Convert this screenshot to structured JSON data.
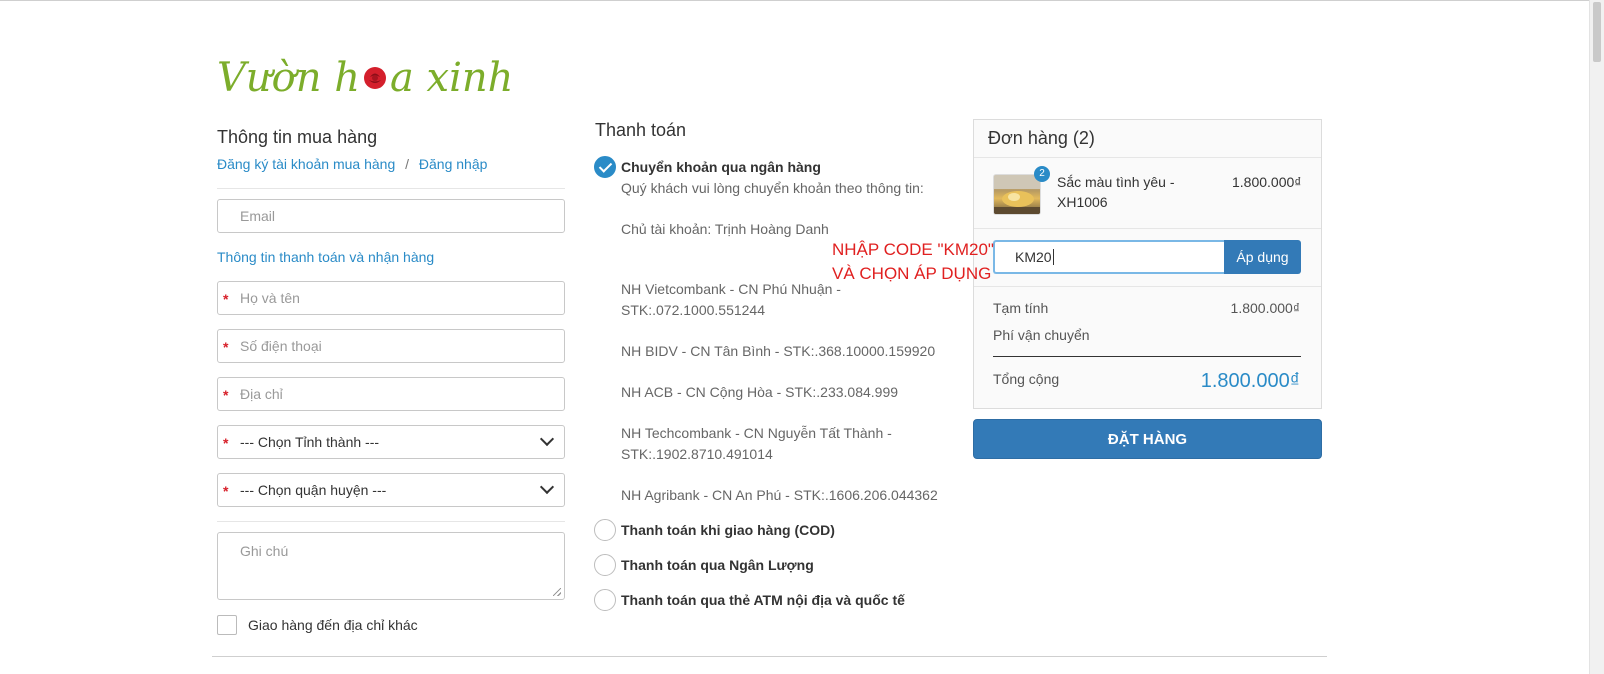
{
  "logo": {
    "text_before": "Vườn h",
    "text_after": "a xinh"
  },
  "purchase_info": {
    "title": "Thông tin mua hàng",
    "register_link": "Đăng ký tài khoản mua hàng",
    "separator": "/",
    "login_link": "Đăng nhập",
    "email_placeholder": "Email",
    "shipping_info_link": "Thông tin thanh toán và nhận hàng",
    "required_mark": "*",
    "fullname_placeholder": "Họ và tên",
    "phone_placeholder": "Số điện thoại",
    "address_placeholder": "Địa chỉ",
    "province_select": "--- Chọn Tỉnh thành ---",
    "district_select": "--- Chọn quận huyện ---",
    "note_placeholder": "Ghi chú",
    "ship_other_label": "Giao hàng đến địa chỉ khác"
  },
  "payment": {
    "title": "Thanh toán",
    "bank_transfer": {
      "label": "Chuyển khoản qua ngân hàng",
      "intro": "Quý khách vui lòng chuyển khoản theo thông tin:",
      "owner": "Chủ tài khoản: Trịnh Hoàng Danh",
      "vcb_line1": "NH Vietcombank - CN Phú Nhuận -",
      "vcb_line2": "STK:.072.1000.551244",
      "bidv": "NH BIDV - CN Tân Bình - STK:.368.10000.159920",
      "acb": "NH ACB - CN Cộng Hòa - STK:.233.084.999",
      "tcb_line1": "NH Techcombank - CN Nguyễn Tất Thành -",
      "tcb_line2": "STK:.1902.8710.491014",
      "agribank": "NH Agribank - CN An Phú - STK:.1606.206.044362"
    },
    "cod_label": "Thanh toán khi giao hàng (COD)",
    "nganluong_label": "Thanh toán qua Ngân Lượng",
    "atm_label": "Thanh toán qua thẻ ATM nội địa và quốc tế"
  },
  "order": {
    "title": "Đơn hàng (2)",
    "item": {
      "qty": "2",
      "name": "Sắc màu tình yêu - XH1006",
      "price": "1.800.000₫"
    },
    "coupon_value": "KM20",
    "apply_button": "Áp dụng",
    "subtotal_label": "Tạm tính",
    "subtotal_value": "1.800.000₫",
    "shipping_label": "Phí vận chuyển",
    "total_label": "Tổng cộng",
    "total_value": "1.800.000₫",
    "place_order_button": "ĐẶT HÀNG"
  },
  "annotation": {
    "line1": "NHẬP CODE \"KM20\"",
    "line2": "VÀ CHỌN ÁP DỤNG"
  },
  "colors": {
    "link": "#2a8bc7",
    "primary_button": "#337ab7",
    "logo_green": "#7cad2b",
    "annotation_red": "#e02020",
    "required_red": "#d7202a"
  }
}
